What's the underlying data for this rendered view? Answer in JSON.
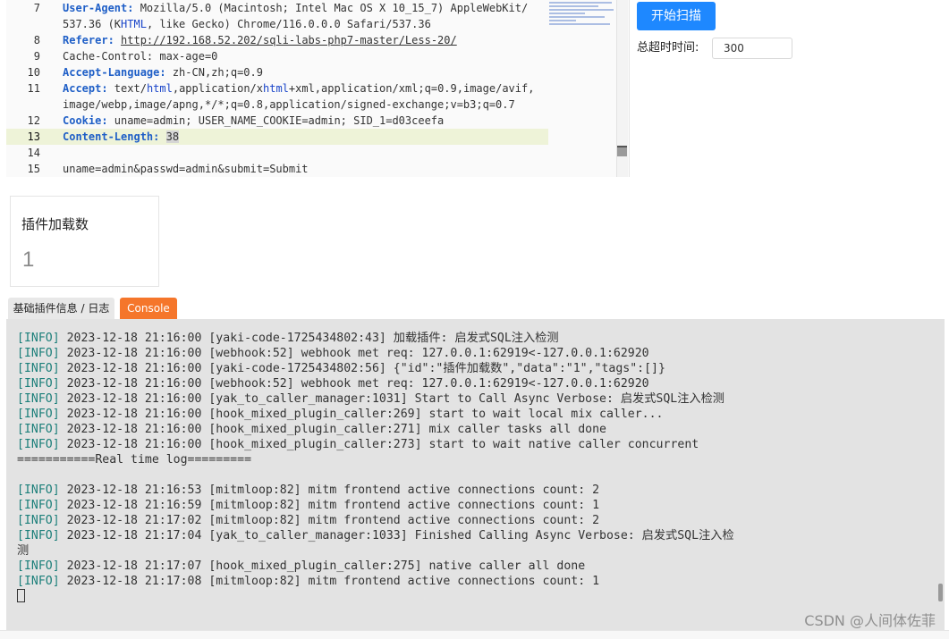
{
  "editor": {
    "lines": [
      {
        "num": "7",
        "parts": [
          {
            "text": "User-Agent:",
            "style": "k"
          },
          {
            "text": " Mozilla/5.0 (Macintosh; Intel Mac OS X 10_15_7) AppleWebKit/"
          }
        ]
      },
      {
        "num": "",
        "parts": [
          {
            "text": "537.36 (K"
          },
          {
            "text": "HTML",
            "style": "tag"
          },
          {
            "text": ", like Gecko) Chrome/116.0.0.0 Safari/537.36"
          }
        ]
      },
      {
        "num": "8",
        "parts": [
          {
            "text": "Referer:",
            "style": "k"
          },
          {
            "text": " "
          },
          {
            "text": "http://192.168.52.202/sqli-labs-php7-master/Less-20/",
            "style": "u"
          }
        ]
      },
      {
        "num": "9",
        "parts": [
          {
            "text": "Cache-Control: max-age=0"
          }
        ]
      },
      {
        "num": "10",
        "parts": [
          {
            "text": "Accept-Language:",
            "style": "k"
          },
          {
            "text": " zh-CN,zh;q=0.9"
          }
        ]
      },
      {
        "num": "11",
        "parts": [
          {
            "text": "Accept:",
            "style": "k"
          },
          {
            "text": " text/"
          },
          {
            "text": "html",
            "style": "tag"
          },
          {
            "text": ",application/x"
          },
          {
            "text": "html",
            "style": "tag"
          },
          {
            "text": "+xml,application/xml;q=0.9,image/avif,"
          }
        ]
      },
      {
        "num": "",
        "parts": [
          {
            "text": "image/webp,image/apng,*/*;q=0.8,application/signed-exchange;v=b3;q=0.7"
          }
        ]
      },
      {
        "num": "12",
        "parts": [
          {
            "text": "Cookie:",
            "style": "k"
          },
          {
            "text": " uname=admin; USER_NAME_COOKIE=admin; SID_1=d03ceefa"
          }
        ]
      },
      {
        "num": "13",
        "active": true,
        "parts": [
          {
            "text": "Content-Length:",
            "style": "k"
          },
          {
            "text": " "
          },
          {
            "text": "38",
            "style": "sel"
          }
        ]
      },
      {
        "num": "14",
        "parts": []
      },
      {
        "num": "15",
        "parts": [
          {
            "text": "uname=admin&passwd=admin&submit=Submit"
          }
        ]
      }
    ]
  },
  "scan": {
    "start_label": "开始扫描",
    "timeout_label": "总超时时间:",
    "timeout_value": "300"
  },
  "stats": {
    "title": "插件加载数",
    "value": "1"
  },
  "tabs": {
    "info_label": "基础插件信息 / 日志",
    "console_label": "Console"
  },
  "console": {
    "lines": [
      {
        "level": "[INFO]",
        "text": " 2023-12-18 21:16:00 [yaki-code-1725434802:43] 加载插件: 启发式SQL注入检测"
      },
      {
        "level": "[INFO]",
        "text": " 2023-12-18 21:16:00 [webhook:52] webhook met req: 127.0.0.1:62919<-127.0.0.1:62920"
      },
      {
        "level": "[INFO]",
        "text": " 2023-12-18 21:16:00 [yaki-code-1725434802:56] {\"id\":\"插件加载数\",\"data\":\"1\",\"tags\":[]}"
      },
      {
        "level": "[INFO]",
        "text": " 2023-12-18 21:16:00 [webhook:52] webhook met req: 127.0.0.1:62919<-127.0.0.1:62920"
      },
      {
        "level": "[INFO]",
        "text": " 2023-12-18 21:16:00 [yak_to_caller_manager:1031] Start to Call Async Verbose: 启发式SQL注入检测"
      },
      {
        "level": "[INFO]",
        "text": " 2023-12-18 21:16:00 [hook_mixed_plugin_caller:269] start to wait local mix caller..."
      },
      {
        "level": "[INFO]",
        "text": " 2023-12-18 21:16:00 [hook_mixed_plugin_caller:271] mix caller tasks all done"
      },
      {
        "level": "[INFO]",
        "text": " 2023-12-18 21:16:00 [hook_mixed_plugin_caller:273] start to wait native caller concurrent"
      },
      {
        "level": "",
        "text": "===========Real time log========="
      },
      {
        "level": "",
        "text": ""
      },
      {
        "level": "[INFO]",
        "text": " 2023-12-18 21:16:53 [mitmloop:82] mitm frontend active connections count: 2"
      },
      {
        "level": "[INFO]",
        "text": " 2023-12-18 21:16:59 [mitmloop:82] mitm frontend active connections count: 1"
      },
      {
        "level": "[INFO]",
        "text": " 2023-12-18 21:17:02 [mitmloop:82] mitm frontend active connections count: 2"
      },
      {
        "level": "[INFO]",
        "text": " 2023-12-18 21:17:04 [yak_to_caller_manager:1033] Finished Calling Async Verbose: 启发式SQL注入检"
      },
      {
        "level": "",
        "text": "测"
      },
      {
        "level": "[INFO]",
        "text": " 2023-12-18 21:17:07 [hook_mixed_plugin_caller:275] native caller all done"
      },
      {
        "level": "[INFO]",
        "text": " 2023-12-18 21:17:08 [mitmloop:82] mitm frontend active connections count: 1"
      }
    ]
  },
  "watermark": "CSDN @人间体佐菲"
}
